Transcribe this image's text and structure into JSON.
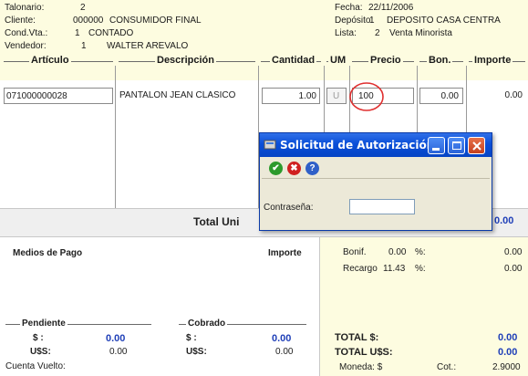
{
  "header": {
    "talonario_label": "Talonario:",
    "talonario_value": "2",
    "cliente_label": "Cliente:",
    "cliente_code": "000000",
    "cliente_name": "CONSUMIDOR FINAL",
    "condvta_label": "Cond.Vta.:",
    "condvta_code": "1",
    "condvta_name": "CONTADO",
    "vendedor_label": "Vendedor:",
    "vendedor_code": "1",
    "vendedor_name": "WALTER AREVALO",
    "fecha_label": "Fecha:",
    "fecha_value": "22/11/2006",
    "deposito_label": "Depósito:",
    "deposito_code": "1",
    "deposito_name": "DEPOSITO CASA CENTRA",
    "lista_label": "Lista:",
    "lista_code": "2",
    "lista_name": "Venta Minorista"
  },
  "columns": {
    "articulo": "Artículo",
    "descripcion": "Descripción",
    "cantidad": "Cantidad",
    "um": "UM",
    "precio": "Precio",
    "bon": "Bon.",
    "importe": "Importe"
  },
  "row": {
    "articulo": "071000000028",
    "descripcion": "PANTALON JEAN CLASICO",
    "cantidad": "1.00",
    "um": "U",
    "precio": "100",
    "bon": "0.00",
    "importe": "0.00"
  },
  "totals": {
    "total_label": "Total Uni",
    "total_value": "0.00"
  },
  "payments": {
    "medios_label": "Medios de Pago",
    "importe_label": "Importe",
    "pendiente_label": "Pendiente",
    "cobrado_label": "Cobrado",
    "peso_label": "$ :",
    "usd_label": "U$S:",
    "pendiente_peso": "0.00",
    "pendiente_usd": "0.00",
    "cobrado_peso": "0.00",
    "cobrado_usd": "0.00",
    "vuelto_label": "Cuenta Vuelto:"
  },
  "summary": {
    "bonif_label": "Bonif.",
    "bonif_value": "0.00",
    "bonif_pct": "%:",
    "bonif_amount": "0.00",
    "recargo_label": "Recargo",
    "recargo_value": "11.43",
    "recargo_pct": "%:",
    "recargo_amount": "0.00",
    "total_peso_label": "TOTAL $:",
    "total_peso_value": "0.00",
    "total_usd_label": "TOTAL U$S:",
    "total_usd_value": "0.00",
    "moneda_label": "Moneda: $",
    "cot_label": "Cot.:",
    "cot_value": "2.9000"
  },
  "dialog": {
    "title": "Solicitud de Autorización",
    "password_label": "Contraseña:",
    "password_value": ""
  },
  "colors": {
    "header_bg": "#fdfce0",
    "titlebar_blue": "#0a4fd8",
    "accent_blue": "#1f3fb8",
    "highlight_red": "#e03030"
  }
}
